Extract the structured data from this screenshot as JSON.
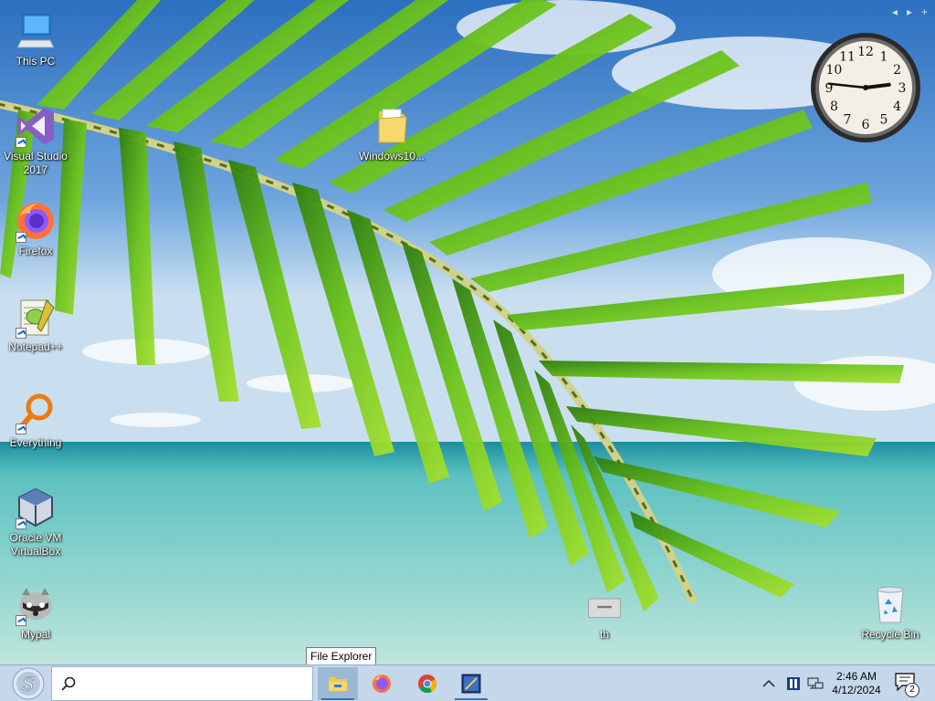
{
  "desktop": {
    "icons": [
      {
        "label": "This PC",
        "icon": "computer-icon"
      },
      {
        "label": "Visual Studio 2017",
        "icon": "visual-studio-icon"
      },
      {
        "label": "Firefox",
        "icon": "firefox-icon"
      },
      {
        "label": "Notepad++",
        "icon": "notepadpp-icon"
      },
      {
        "label": "Everything",
        "icon": "search-magnifier-icon"
      },
      {
        "label": "Oracle VM VirtualBox",
        "icon": "virtualbox-icon"
      },
      {
        "label": "Mypal",
        "icon": "raccoon-icon"
      },
      {
        "label": "Windows10...",
        "icon": "folder-icon"
      },
      {
        "label": "th",
        "icon": "drive-icon"
      },
      {
        "label": "Recycle Bin",
        "icon": "recycle-bin-icon"
      }
    ]
  },
  "gadget": {
    "prev": "◂",
    "next": "▸",
    "add": "+",
    "clock_numbers": [
      "12",
      "1",
      "2",
      "3",
      "4",
      "5",
      "6",
      "7",
      "8",
      "9",
      "10",
      "11"
    ],
    "hour": 2,
    "minute": 46
  },
  "tooltip": {
    "text": "File Explorer"
  },
  "taskbar": {
    "search_placeholder": "",
    "apps": [
      {
        "name": "File Explorer",
        "icon": "file-explorer-icon"
      },
      {
        "name": "Firefox",
        "icon": "firefox-icon"
      },
      {
        "name": "Chrome",
        "icon": "chrome-icon"
      },
      {
        "name": "Sizer",
        "icon": "app-window-icon"
      }
    ],
    "time": "2:46 AM",
    "date": "4/12/2024",
    "notification_count": "2"
  },
  "colors": {
    "taskbar_bg": "#c5d7ea",
    "sky": "#3d7fc8",
    "sea": "#7fcfc6",
    "leaf": "#5cb817"
  }
}
